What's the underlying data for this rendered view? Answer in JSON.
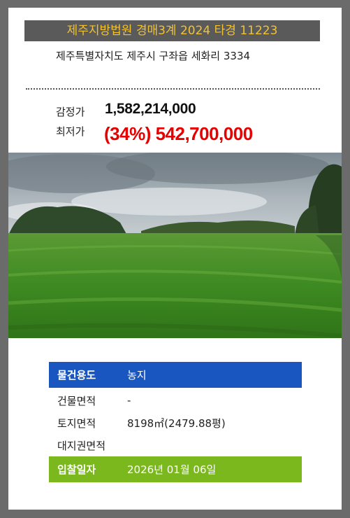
{
  "header": {
    "title": "제주지방법원 경매3계 2024 타경 11223",
    "address": "제주특별자치도 제주시 구좌읍 세화리 3334"
  },
  "prices": {
    "appraisal_label": "감정가",
    "appraisal_value": "1,582,214,000",
    "minimum_label": "최저가",
    "minimum_value": "(34%) 542,700,000"
  },
  "details": {
    "usage_label": "물건용도",
    "usage_value": "농지",
    "building_area_label": "건물면적",
    "building_area_value": "-",
    "land_area_label": "토지면적",
    "land_area_value": "8198㎡(2479.88평)",
    "land_right_label": "대지권면적",
    "land_right_value": "",
    "bid_date_label": "입찰일자",
    "bid_date_value": "2026년 01월 06일"
  },
  "colors": {
    "title_bg": "#5a5a5a",
    "title_text": "#f2c230",
    "minimum_price": "#e60000",
    "usage_row": "#1a56c0",
    "bid_row": "#7ab81e"
  }
}
